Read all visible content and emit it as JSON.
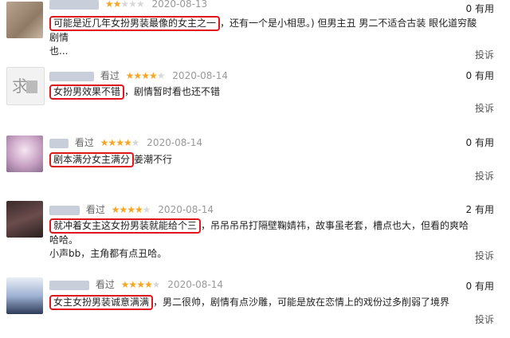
{
  "reviews": [
    {
      "status": "",
      "stars": 2,
      "date": "2020-08-13",
      "highlight": "可能是近几年女扮男装最像的女主之一",
      "rest": "，还有一个是小相思。) 但男主丑 男二不适合古装 眼化道穷酸 剧情",
      "line2": "也...",
      "useful": "0 有用",
      "report": "投诉"
    },
    {
      "status": "看过",
      "stars": 4,
      "date": "2020-08-14",
      "highlight": "女扮男效果不错",
      "rest": "，剧情暂时看也还不错",
      "line2": "",
      "useful": "0 有用",
      "report": "投诉"
    },
    {
      "status": "看过",
      "stars": 4,
      "date": "2020-08-14",
      "highlight": "剧本满分女主满分",
      "rest": "姜潮不行",
      "line2": "",
      "useful": "0 有用",
      "report": "投诉"
    },
    {
      "status": "看过",
      "stars": 4,
      "date": "2020-08-14",
      "highlight": "就冲着女主这女扮男装就能给个三",
      "rest": "，吊吊吊吊打隔壁鞠婧祎，故事虽老套，槽点也大，但看的爽哈哈哈。",
      "line2": "小声bb，主角都有点丑哈。",
      "useful": "2 有用",
      "report": "投诉"
    },
    {
      "status": "看过",
      "stars": 4,
      "date": "2020-08-14",
      "highlight": "女主女扮男装诚意满满",
      "rest": "，男二很帅，剧情有点沙雕，可能是放在恋情上的戏份过多削弱了境界",
      "line2": "",
      "useful": "0 有用",
      "report": "投诉"
    }
  ],
  "colors": {
    "star": "#f5a623",
    "highlight_border": "#e0161a",
    "date": "#999999"
  }
}
